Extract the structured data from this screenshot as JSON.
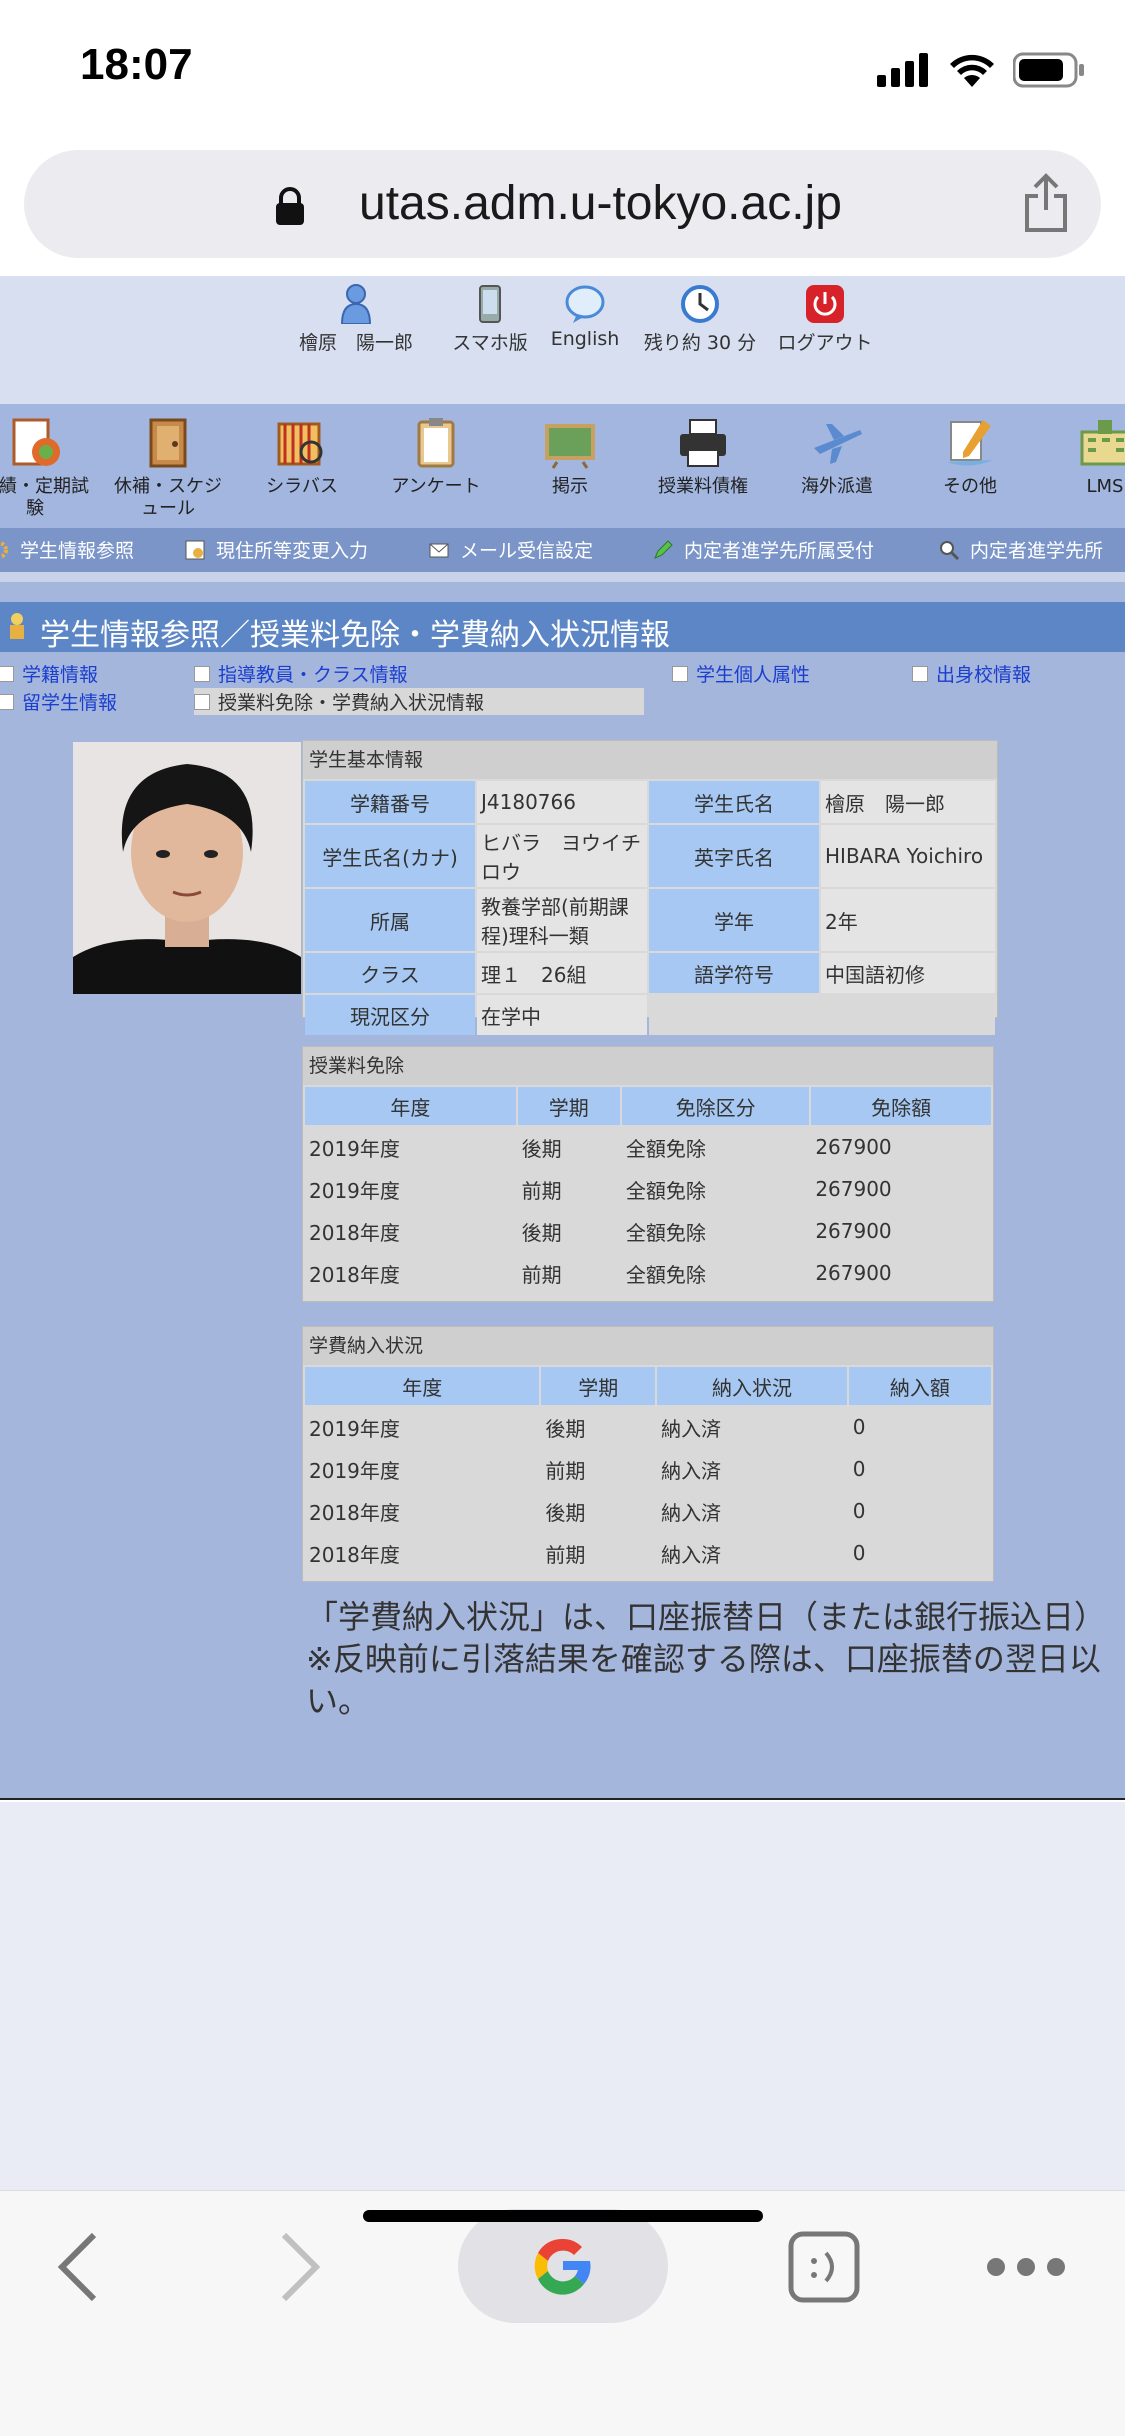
{
  "status_bar": {
    "time": "18:07"
  },
  "browser": {
    "url": "utas.adm.u-tokyo.ac.jp"
  },
  "top_nav": {
    "user": "檜原　陽一郎",
    "smartphone": "スマホ版",
    "english": "English",
    "remaining": "残り約 30 分",
    "logout": "ログアウト"
  },
  "icon_bar": [
    {
      "label": "成績・定期試験"
    },
    {
      "label": "休補・スケジュール"
    },
    {
      "label": "シラバス"
    },
    {
      "label": "アンケート"
    },
    {
      "label": "掲示"
    },
    {
      "label": "授業料債権"
    },
    {
      "label": "海外派遣"
    },
    {
      "label": "その他"
    },
    {
      "label": "LMS"
    }
  ],
  "sub_nav": [
    {
      "label": "学生情報参照"
    },
    {
      "label": "現住所等変更入力"
    },
    {
      "label": "メール受信設定"
    },
    {
      "label": "内定者進学先所属受付"
    },
    {
      "label": "内定者進学先所"
    }
  ],
  "page_title": "学生情報参照／授業料免除・学費納入状況情報",
  "tabs": {
    "gakuseki": "学籍情報",
    "shido": "指導教員・クラス情報",
    "kojin": "学生個人属性",
    "shusshin": "出身校情報",
    "ryugaku": "留学生情報",
    "menjo": "授業料免除・学費納入状況情報"
  },
  "basic_info": {
    "header": "学生基本情報",
    "rows": [
      {
        "l1": "学籍番号",
        "v1": "J4180766",
        "l2": "学生氏名",
        "v2": "檜原　陽一郎"
      },
      {
        "l1": "学生氏名(カナ)",
        "v1": "ヒバラ　ヨウイチロウ",
        "l2": "英字氏名",
        "v2": "HIBARA Yoichiro"
      },
      {
        "l1": "所属",
        "v1": "教養学部(前期課程)理科一類",
        "l2": "学年",
        "v2": "2年"
      },
      {
        "l1": "クラス",
        "v1": "理１　26組",
        "l2": "語学符号",
        "v2": "中国語初修"
      },
      {
        "l1": "現況区分",
        "v1": "在学中",
        "l2": "",
        "v2": ""
      }
    ]
  },
  "exemption": {
    "header": "授業料免除",
    "columns": [
      "年度",
      "学期",
      "免除区分",
      "免除額"
    ],
    "rows": [
      [
        "2019年度",
        "後期",
        "全額免除",
        "267900"
      ],
      [
        "2019年度",
        "前期",
        "全額免除",
        "267900"
      ],
      [
        "2018年度",
        "後期",
        "全額免除",
        "267900"
      ],
      [
        "2018年度",
        "前期",
        "全額免除",
        "267900"
      ]
    ]
  },
  "payment": {
    "header": "学費納入状況",
    "columns": [
      "年度",
      "学期",
      "納入状況",
      "納入額"
    ],
    "rows": [
      [
        "2019年度",
        "後期",
        "納入済",
        "0"
      ],
      [
        "2019年度",
        "前期",
        "納入済",
        "0"
      ],
      [
        "2018年度",
        "後期",
        "納入済",
        "0"
      ],
      [
        "2018年度",
        "前期",
        "納入済",
        "0"
      ]
    ]
  },
  "note": {
    "line1": "「学費納入状況」は、口座振替日（または銀行振込日）",
    "line2": "※反映前に引落結果を確認する際は、口座振替の翌日以",
    "line3": "い。"
  }
}
